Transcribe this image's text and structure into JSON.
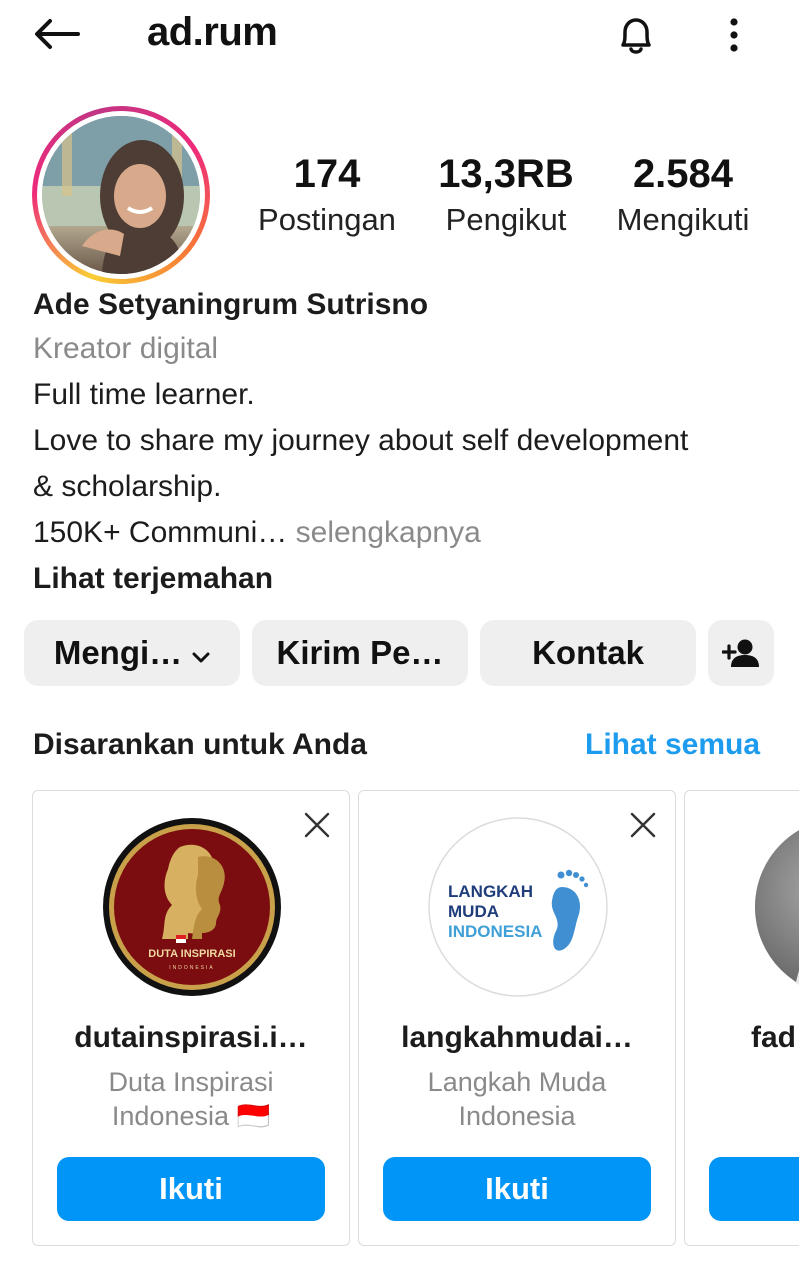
{
  "header": {
    "username": "ad.rum"
  },
  "stats": {
    "posts": {
      "value": "174",
      "label": "Postingan"
    },
    "followers": {
      "value": "13,3RB",
      "label": "Pengikut"
    },
    "following": {
      "value": "2.584",
      "label": "Mengikuti"
    }
  },
  "bio": {
    "name": "Ade Setyaningrum Sutrisno",
    "category": "Kreator digital",
    "line1": "Full time learner.",
    "line2": "Love to share my journey about self development",
    "line3": "& scholarship.",
    "line4": "150K+ Communi…",
    "more": "selengkapnya",
    "translate": "Lihat terjemahan"
  },
  "actions": {
    "following_label": "Mengi…",
    "message_label": "Kirim Pe…",
    "contact_label": "Kontak"
  },
  "suggestions": {
    "title": "Disarankan untuk Anda",
    "see_all": "Lihat semua",
    "cards": [
      {
        "username": "dutainspirasi.i…",
        "fullname_line1": "Duta Inspirasi",
        "fullname_line2": "Indonesia 🇮🇩",
        "follow_label": "Ikuti",
        "logo_text": "DUTA INSPIRASI",
        "logo_subtext": "INDONESIA"
      },
      {
        "username": "langkahmudai…",
        "fullname_line1": "Langkah Muda",
        "fullname_line2": "Indonesia",
        "follow_label": "Ikuti",
        "logo_line1": "LANGKAH",
        "logo_line2": "MUDA",
        "logo_line3": "INDONESIA"
      },
      {
        "username": "fad",
        "follow_label": ""
      }
    ]
  },
  "colors": {
    "accent": "#0095f6",
    "link": "#1c9bef",
    "muted": "#8a8a8a"
  }
}
